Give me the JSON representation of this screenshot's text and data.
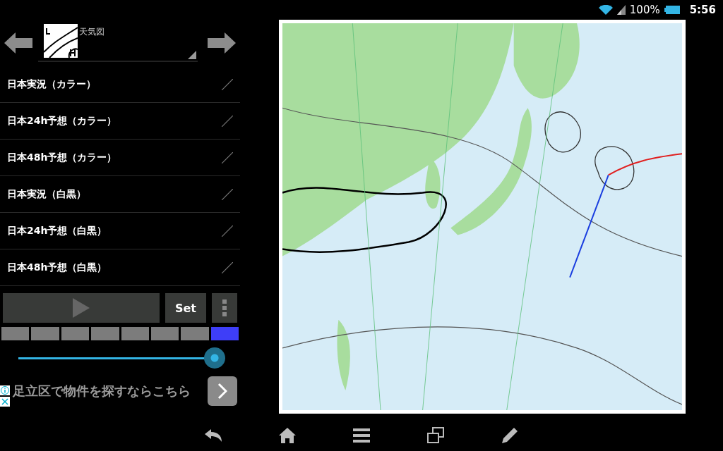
{
  "status_bar": {
    "battery": "100%",
    "time": "5:56"
  },
  "selector": {
    "label": "天気図"
  },
  "menu_items": [
    {
      "label": "日本実況（カラー）"
    },
    {
      "label": "日本24h予想（カラー）"
    },
    {
      "label": "日本48h予想（カラー）"
    },
    {
      "label": "日本実況（白黒）"
    },
    {
      "label": "日本24h予想（白黒）"
    },
    {
      "label": "日本48h予想（白黒）"
    }
  ],
  "set_button": "Set",
  "frames": [
    {
      "selected": false
    },
    {
      "selected": false
    },
    {
      "selected": false
    },
    {
      "selected": false
    },
    {
      "selected": false
    },
    {
      "selected": false
    },
    {
      "selected": false
    },
    {
      "selected": true
    }
  ],
  "slider": {
    "level": 1
  },
  "ad": {
    "text": "足立区で物件を探すならこちら"
  }
}
